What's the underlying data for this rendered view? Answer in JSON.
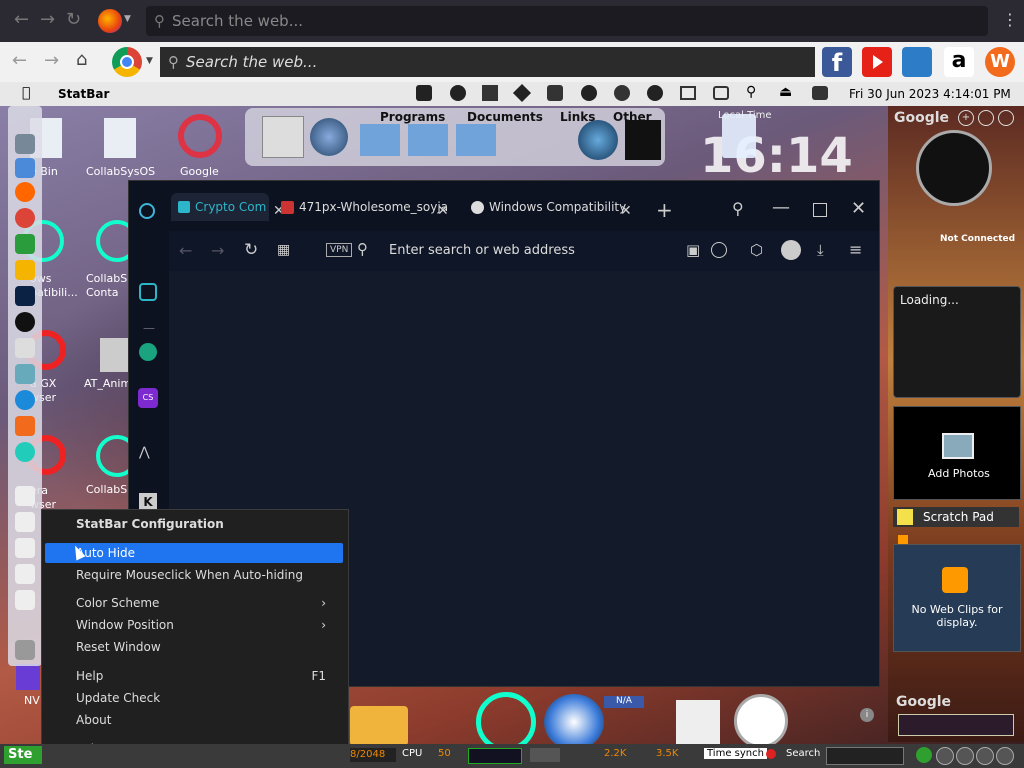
{
  "firefox_bar": {
    "search_placeholder": "Search the web..."
  },
  "chrome_bar": {
    "search_placeholder": "Search the web..."
  },
  "menubar": {
    "app_name": "StatBar",
    "datetime": "Fri 30 Jun 2023  4:14:01 PM"
  },
  "dock_top": {
    "items": [
      "Programs",
      "Documents",
      "Links",
      "Other"
    ],
    "clock_label": "Local Time",
    "clock_time": "16:14"
  },
  "desktop_icons": [
    {
      "label": "e Bin"
    },
    {
      "label": "CollabSysOS"
    },
    {
      "label": "Google"
    },
    {
      "label": "ows\npatibili..."
    },
    {
      "label": "CollabS\nConta"
    },
    {
      "label": "a GX\nwser"
    },
    {
      "label": "AT_Anim"
    },
    {
      "label": "era\nwser"
    },
    {
      "label": "CollabS"
    },
    {
      "label": "NV"
    }
  ],
  "browser": {
    "tabs": [
      {
        "label": "Crypto Com"
      },
      {
        "label": "471px-Wholesome_soyja"
      },
      {
        "label": "Windows Compatibility"
      }
    ],
    "vpn_label": "VPN",
    "address_placeholder": "Enter search or web address"
  },
  "context_menu": {
    "title": "StatBar Configuration",
    "items": [
      {
        "label": "Auto Hide",
        "highlighted": true
      },
      {
        "label": "Require Mouseclick When Auto-hiding"
      },
      {
        "label": "Color Scheme",
        "submenu": true
      },
      {
        "label": "Window Position",
        "submenu": true
      },
      {
        "label": "Reset Window"
      },
      {
        "label": "Help",
        "shortcut": "F1"
      },
      {
        "label": "Update Check"
      },
      {
        "label": "About"
      },
      {
        "label": "Exit"
      }
    ]
  },
  "sidebar": {
    "google_label": "Google",
    "not_connected": "Not Connected",
    "loading": "Loading...",
    "add_photos": "Add Photos",
    "scratch_pad": "Scratch Pad",
    "web_clips": "No Web Clips for display.",
    "google_search_label": "Google"
  },
  "statbar": {
    "start_label": "Ste",
    "ram": "8/2048",
    "cpu_label": "CPU",
    "cpu_value": "50",
    "net_up": "2.2K",
    "net_down": "3.5K",
    "time_sync": "Time synch",
    "search_label": "Search"
  },
  "colors": {
    "highlight": "#1f74f0",
    "menu_bg": "#202020",
    "statbar_green": "#2fa02f"
  }
}
